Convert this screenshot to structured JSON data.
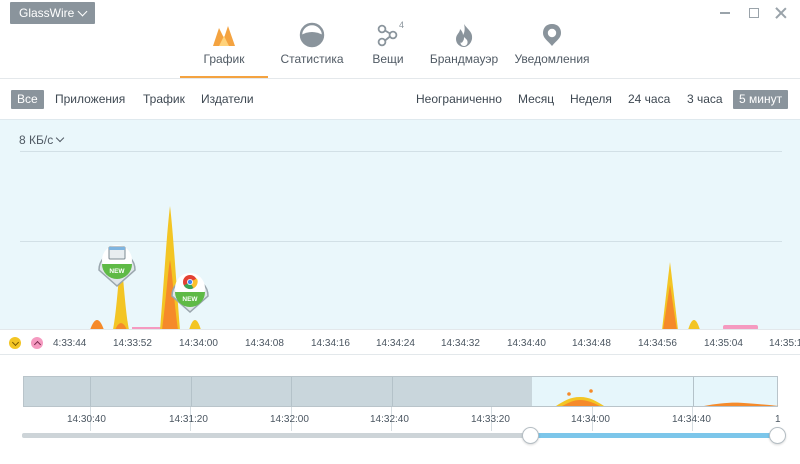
{
  "app": {
    "name": "GlassWire"
  },
  "main_tabs": [
    {
      "label": "График",
      "icon": "graph-icon",
      "active": true
    },
    {
      "label": "Статистика",
      "icon": "stats-icon"
    },
    {
      "label": "Вещи",
      "icon": "things-icon",
      "badge": "4"
    },
    {
      "label": "Брандмауэр",
      "icon": "firewall-icon"
    },
    {
      "label": "Уведомления",
      "icon": "notifications-icon"
    }
  ],
  "filters": {
    "left": [
      "Все",
      "Приложения",
      "Трафик",
      "Издатели"
    ],
    "left_selected": "Все",
    "right": [
      "Неограниченно",
      "Месяц",
      "Неделя",
      "24 часа",
      "3 часа",
      "5 минут"
    ],
    "right_selected": "5 минут"
  },
  "graph": {
    "unit_label": "8 КБ/с",
    "app_markers": [
      {
        "badge": "NEW",
        "icon": "window-app-icon"
      },
      {
        "badge": "NEW",
        "icon": "chrome-icon"
      }
    ]
  },
  "time_axis": {
    "ticks": [
      "4:33:44",
      "14:33:52",
      "14:34:00",
      "14:34:08",
      "14:34:16",
      "14:34:24",
      "14:34:32",
      "14:34:40",
      "14:34:48",
      "14:34:56",
      "14:35:04",
      "14:35:1"
    ]
  },
  "overview": {
    "ticks": [
      "14:30:40",
      "14:31:20",
      "14:32:00",
      "14:32:40",
      "14:33:20",
      "14:34:00",
      "14:34:40",
      "1"
    ]
  },
  "colors": {
    "download": "#f3c524",
    "upload": "#f59ac0",
    "peak": "#f58a2a",
    "accent": "#f4a340",
    "graph_bg": "#eaf7fb",
    "slider": "#7cc6ea"
  }
}
